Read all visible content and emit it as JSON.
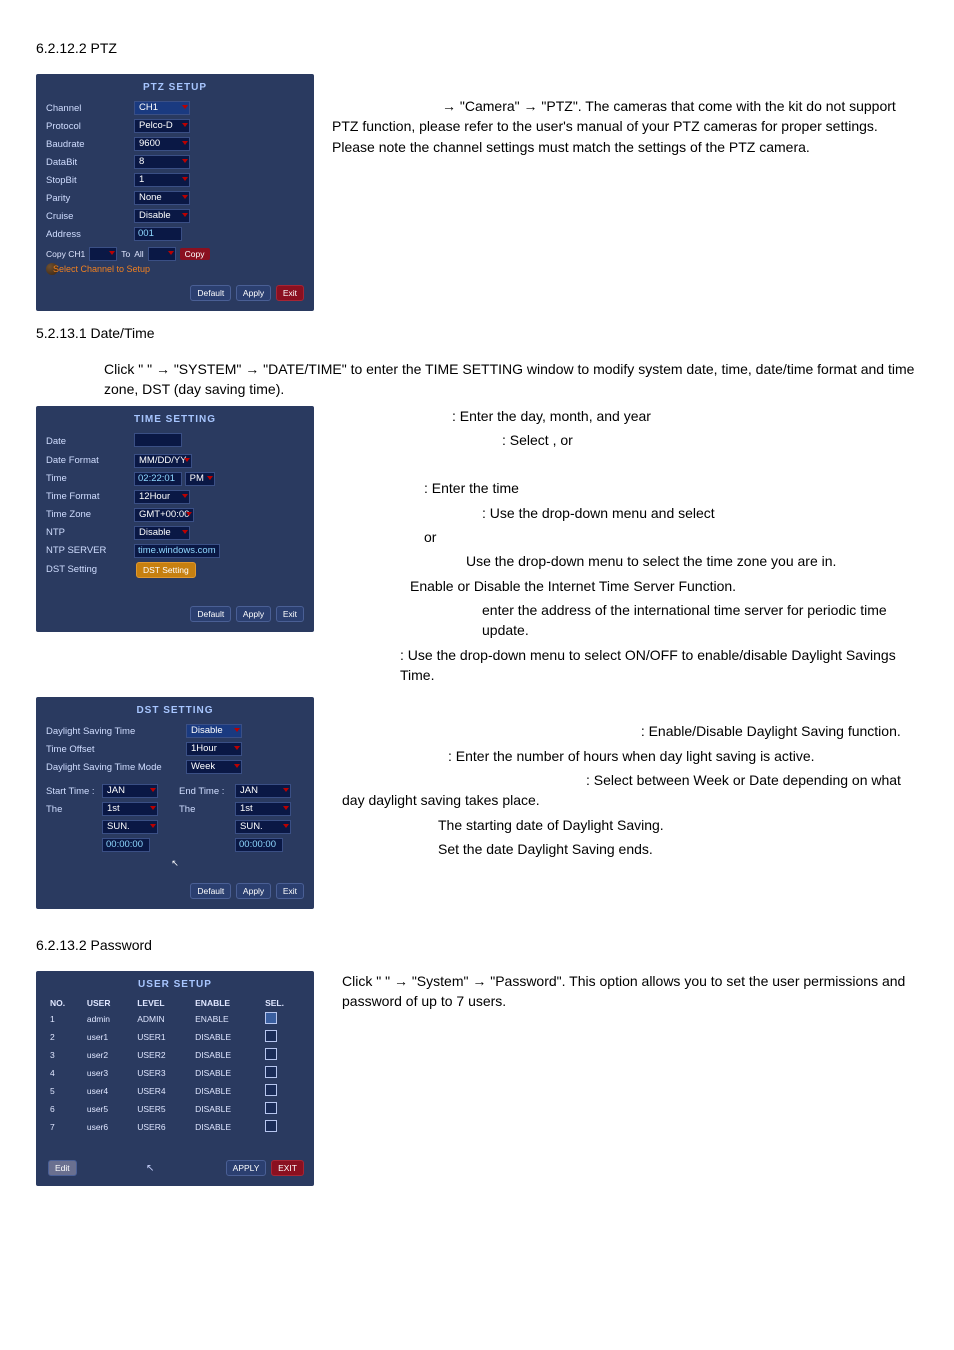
{
  "headings": {
    "h_ptz": "6.2.12.2 PTZ",
    "h_datetime": "5.2.13.1 Date/Time",
    "h_password": "6.2.13.2 Password"
  },
  "ptz_panel": {
    "title": "PTZ SETUP",
    "rows": [
      {
        "k": "Channel",
        "v": "CH1"
      },
      {
        "k": "Protocol",
        "v": "Pelco-D"
      },
      {
        "k": "Baudrate",
        "v": "9600"
      },
      {
        "k": "DataBit",
        "v": "8"
      },
      {
        "k": "StopBit",
        "v": "1"
      },
      {
        "k": "Parity",
        "v": "None"
      },
      {
        "k": "Cruise",
        "v": "Disable"
      },
      {
        "k": "Address",
        "v": "001"
      }
    ],
    "copy": {
      "prefix": "Copy CH1",
      "to": "To",
      "all": "All",
      "btn": "Copy"
    },
    "select_line": "Select Channel to Setup",
    "buttons": [
      "Default",
      "Apply",
      "Exit"
    ]
  },
  "ptz_text": {
    "l1": "→ \"Camera\" → \"PTZ\".   The cameras that come with the kit do not support PTZ function, please refer to the user's manual of your PTZ cameras for proper settings.   Please note the channel settings must match the settings of the PTZ camera."
  },
  "dt_intro": {
    "line": "Click \"               \" → \"SYSTEM\" → \"DATE/TIME\" to enter the TIME SETTING window to modify system date, time, date/time format and time zone, DST (day saving time)."
  },
  "time_panel": {
    "title": "TIME SETTING",
    "rows": [
      {
        "k": "Date",
        "inp": "          "
      },
      {
        "k": "Date Format",
        "v": "MM/DD/YY"
      },
      {
        "k": "Time",
        "inp": "02:22:01",
        "suffix": "PM"
      },
      {
        "k": "Time Format",
        "v": "12Hour"
      },
      {
        "k": "Time Zone",
        "v": "GMT+00:00"
      },
      {
        "k": "NTP",
        "v": "Disable"
      },
      {
        "k": "NTP SERVER",
        "inp": "time.windows.com"
      },
      {
        "k": "DST Setting",
        "btn": "DST Setting"
      }
    ],
    "buttons": [
      "Default",
      "Apply",
      "Exit"
    ]
  },
  "time_text": {
    "l1": ": Enter the day, month, and year",
    "l2": ": Select                   , or",
    "l3": ": Enter the time",
    "l4": ": Use the drop-down menu and select",
    "l4b": "or",
    "l5": "Use the drop-down menu to select the time zone you are in.",
    "l6": "Enable or Disable the Internet Time Server Function.",
    "l7": "enter the address of the international time server for periodic time update.",
    "l8": ": Use the drop-down menu to select ON/OFF to enable/disable Daylight Savings Time."
  },
  "dst_panel": {
    "title": "DST SETTING",
    "left": [
      {
        "k": "Daylight Saving Time"
      },
      {
        "k": "Time Offset"
      },
      {
        "k": "Daylight Saving Time Mode"
      }
    ],
    "right_top": [
      {
        "v": "Disable"
      },
      {
        "v": "1Hour"
      },
      {
        "v": "Week"
      }
    ],
    "start_label": "Start Time :",
    "end_label": "End Time :",
    "start": [
      {
        "v": "JAN"
      },
      {
        "k": "The",
        "v": "1st"
      },
      {
        "k": "",
        "v": "SUN."
      },
      {
        "k": "",
        "inp": "00:00:00"
      }
    ],
    "end": [
      {
        "v": "JAN"
      },
      {
        "k": "The",
        "v": "1st"
      },
      {
        "k": "",
        "v": "SUN."
      },
      {
        "k": "",
        "inp": "00:00:00"
      }
    ],
    "buttons": [
      "Default",
      "Apply",
      "Exit"
    ]
  },
  "dst_text": {
    "l1": ": Enable/Disable Daylight Saving function.",
    "l2": ": Enter the number of hours when day light saving is active.",
    "l3": ": Select between Week or Date depending on what day daylight saving takes place.",
    "l4": "The starting date of Daylight Saving.",
    "l5": "Set the date Daylight Saving ends."
  },
  "user_panel": {
    "title": "USER SETUP",
    "cols": [
      "NO.",
      "USER",
      "LEVEL",
      "ENABLE",
      "SEL."
    ],
    "rows": [
      {
        "no": "1",
        "user": "admin",
        "level": "ADMIN",
        "enable": "ENABLE",
        "sel": true
      },
      {
        "no": "2",
        "user": "user1",
        "level": "USER1",
        "enable": "DISABLE",
        "sel": false
      },
      {
        "no": "3",
        "user": "user2",
        "level": "USER2",
        "enable": "DISABLE",
        "sel": false
      },
      {
        "no": "4",
        "user": "user3",
        "level": "USER3",
        "enable": "DISABLE",
        "sel": false
      },
      {
        "no": "5",
        "user": "user4",
        "level": "USER4",
        "enable": "DISABLE",
        "sel": false
      },
      {
        "no": "6",
        "user": "user5",
        "level": "USER5",
        "enable": "DISABLE",
        "sel": false
      },
      {
        "no": "7",
        "user": "user6",
        "level": "USER6",
        "enable": "DISABLE",
        "sel": false
      }
    ],
    "edit_btn": "Edit",
    "buttons": [
      "APPLY",
      "EXIT"
    ]
  },
  "user_text": {
    "l1": "Click \"               \" → \"System\" → \"Password\". This option allows you to set the user permissions and password of up to 7 users."
  }
}
